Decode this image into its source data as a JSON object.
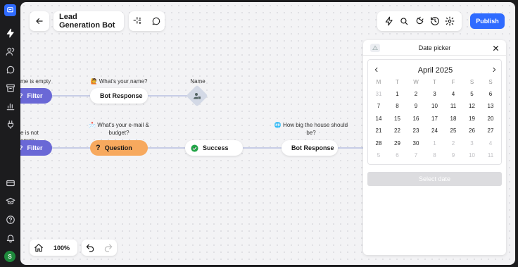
{
  "app": {
    "avatar_initial": "S"
  },
  "rail": {
    "items": [
      "workflow-icon",
      "users-icon",
      "chat-icon",
      "inbox-icon",
      "analytics-icon",
      "integrations-icon"
    ],
    "bottom": [
      "billing-icon",
      "academy-icon",
      "help-icon",
      "notifications-icon"
    ]
  },
  "toolbar": {
    "title": "Lead Generation Bot",
    "publish_label": "Publish"
  },
  "flow": {
    "filter1": {
      "caption": "me is empty",
      "label": "Filter"
    },
    "filter2": {
      "caption": "e is not empty",
      "label": "Filter"
    },
    "bot1": {
      "caption": "🙋 What's your name?",
      "label": "Bot Response"
    },
    "name_node": {
      "caption": "Name"
    },
    "question": {
      "caption_line1": "📩 What's your e-mail &",
      "caption_line2": "budget?",
      "label": "Question"
    },
    "success": {
      "label": "Success"
    },
    "bot2": {
      "caption_line1": "🌐 How big the house should",
      "caption_line2": "be?",
      "label": "Bot Response"
    }
  },
  "zoom": {
    "value": "100%"
  },
  "date_picker": {
    "title": "Date picker",
    "month": "April 2025",
    "weekdays": [
      "M",
      "T",
      "W",
      "T",
      "F",
      "S",
      "S"
    ],
    "weeks": [
      [
        "31",
        "1",
        "2",
        "3",
        "4",
        "5",
        "6"
      ],
      [
        "7",
        "8",
        "9",
        "10",
        "11",
        "12",
        "13"
      ],
      [
        "14",
        "15",
        "16",
        "17",
        "18",
        "19",
        "20"
      ],
      [
        "21",
        "22",
        "23",
        "24",
        "25",
        "26",
        "27"
      ],
      [
        "28",
        "29",
        "30",
        "1",
        "2",
        "3",
        "4"
      ],
      [
        "5",
        "6",
        "7",
        "8",
        "9",
        "10",
        "11"
      ]
    ],
    "select_label": "Select date"
  }
}
